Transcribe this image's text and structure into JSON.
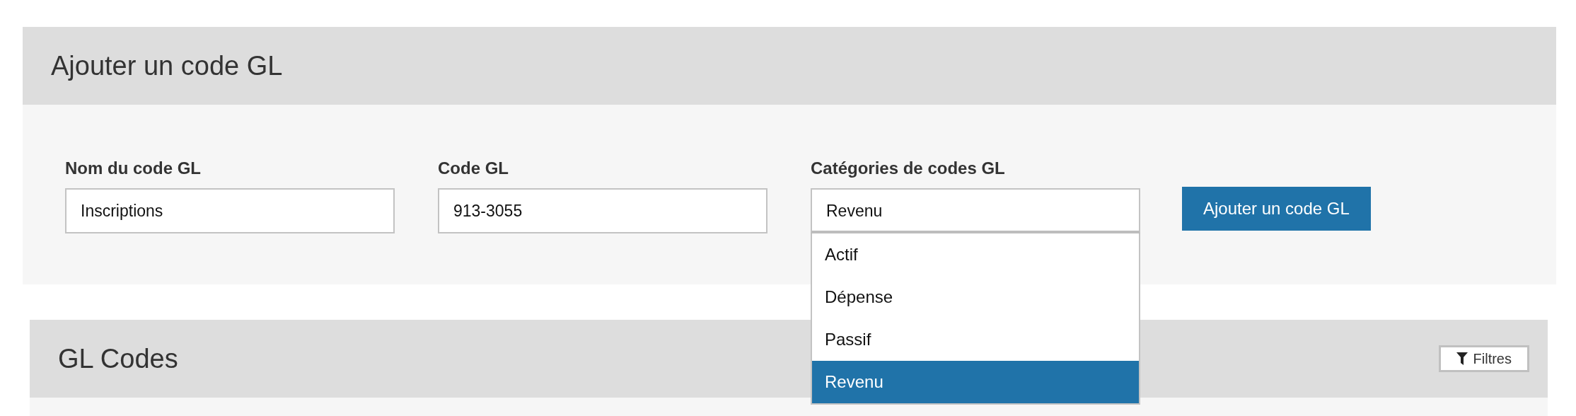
{
  "add_panel": {
    "title": "Ajouter un code GL",
    "fields": [
      {
        "label": "Nom du code GL",
        "value": "Inscriptions"
      },
      {
        "label": "Code GL",
        "value": "913-3055"
      }
    ],
    "category": {
      "label": "Catégories de codes GL",
      "value": "Revenu",
      "expanded": true,
      "options": [
        {
          "label": "Actif",
          "selected": false
        },
        {
          "label": "Dépense",
          "selected": false
        },
        {
          "label": "Passif",
          "selected": false
        },
        {
          "label": "Revenu",
          "selected": true
        }
      ]
    },
    "submit_button": "Ajouter un code GL"
  },
  "codes_panel": {
    "title": "GL Codes",
    "filter_button": "Filtres"
  }
}
